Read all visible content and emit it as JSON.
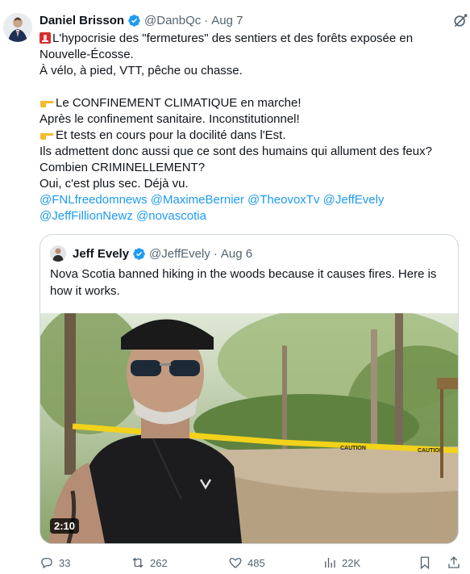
{
  "author": {
    "name": "Daniel Brisson",
    "handle": "@DanbQc",
    "separator": "·",
    "date": "Aug 7"
  },
  "tweet_lines": {
    "l1": "L'hypocrisie des \"fermetures\" des sentiers et des forêts exposée en",
    "l2": "Nouvelle-Écosse.",
    "l3": "À vélo, à pied, VTT, pêche ou chasse.",
    "l5": "Le CONFINEMENT CLIMATIQUE en marche!",
    "l6": "Après le confinement sanitaire. Inconstitutionnel!",
    "l7": "Et tests en cours pour la docilité dans l'Est.",
    "l8": "Ils admettent donc aussi que ce sont des humains qui allument des feux?",
    "l9": "Combien CRIMINELLEMENT?",
    "l10": "Oui, c'est plus sec. Déjà vu.",
    "m1": "@FNLfreedomnews",
    "m2": "@MaximeBernier",
    "m3": "@TheovoxTv",
    "m4": "@JeffEvely",
    "m5": "@JeffFillionNewz",
    "m6": "@novascotia"
  },
  "quoted": {
    "name": "Jeff Evely",
    "handle": "@JeffEvely",
    "separator": "·",
    "date": "Aug 6",
    "text": "Nova Scotia banned hiking in the woods because it causes fires. Here is how it works.",
    "video_duration": "2:10",
    "tape_text": "CAUTION"
  },
  "actions": {
    "replies": "33",
    "reposts": "262",
    "likes": "485",
    "views": "22K"
  },
  "colors": {
    "link": "#1d9bf0",
    "secondary": "#536471",
    "verified": "#1d9bf0",
    "border": "#cfd9de"
  },
  "icons": [
    "verified-badge-icon",
    "grok-icon",
    "siren-emoji-icon",
    "pointing-hand-emoji-icon",
    "reply-icon",
    "repost-icon",
    "like-icon",
    "views-icon",
    "bookmark-icon",
    "share-icon"
  ]
}
